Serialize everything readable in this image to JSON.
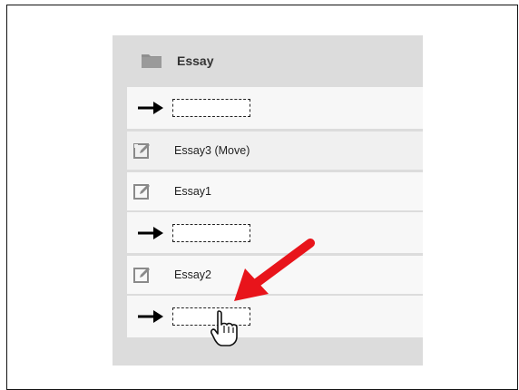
{
  "folder": {
    "label": "Essay",
    "icon": "folder-icon"
  },
  "rows": [
    {
      "type": "drop-target"
    },
    {
      "type": "item",
      "label": "Essay3 (Move)",
      "icon": "edit-icon"
    },
    {
      "type": "item",
      "label": "Essay1",
      "icon": "edit-icon"
    },
    {
      "type": "drop-target"
    },
    {
      "type": "item",
      "label": "Essay2",
      "icon": "edit-icon"
    },
    {
      "type": "drop-target"
    }
  ],
  "colors": {
    "panel_bg": "#dcdcdc",
    "row_bg": "#f0f0f0",
    "drop_row_bg": "#f7f7f7",
    "highlight_arrow": "#e8141b",
    "icon_gray": "#8a8a8a"
  },
  "annotations": {
    "pointer_arrow_icon": "red-arrow-icon",
    "cursor_icon": "hand-pointer-icon"
  }
}
